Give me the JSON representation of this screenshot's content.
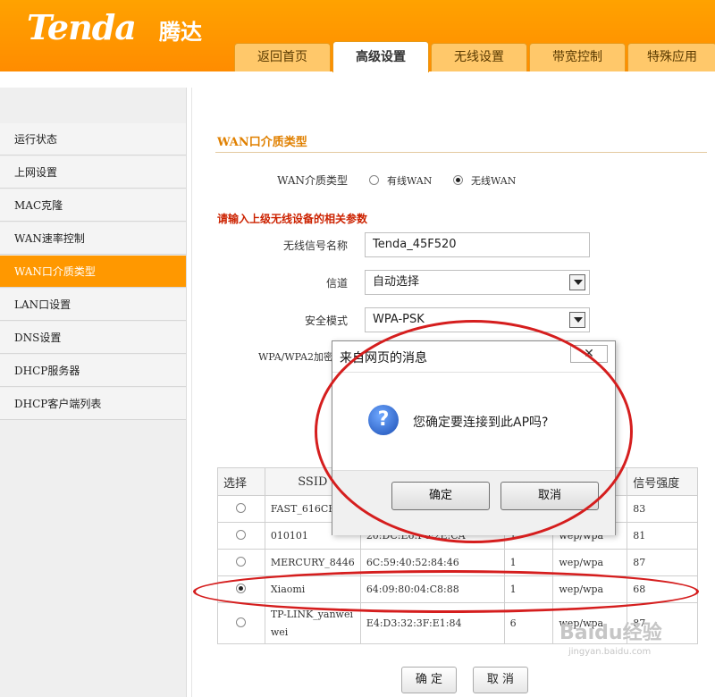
{
  "header": {
    "logo_text": "Tenda",
    "logo_cn": "腾达",
    "tabs": [
      "返回首页",
      "高级设置",
      "无线设置",
      "带宽控制",
      "特殊应用"
    ],
    "active_tab": 1
  },
  "sidebar": {
    "items": [
      "运行状态",
      "上网设置",
      "MAC克隆",
      "WAN速率控制",
      "WAN口介质类型",
      "LAN口设置",
      "DNS设置",
      "DHCP服务器",
      "DHCP客户端列表"
    ],
    "active_index": 4
  },
  "main": {
    "section_title": "WAN口介质类型",
    "media_type_label": "WAN介质类型",
    "radio_wired": "有线WAN",
    "radio_wireless": "无线WAN",
    "radio_selected": "无线WAN",
    "prompt": "请输入上级无线设备的相关参数",
    "ssid_label": "无线信号名称",
    "ssid_value": "Tenda_45F520",
    "channel_label": "信道",
    "channel_value": "自动选择",
    "security_label": "安全模式",
    "security_value": "WPA-PSK",
    "wpa_label": "WPA/WPA2加密规",
    "ok_label": "确 定",
    "cancel_label": "取 消"
  },
  "table": {
    "headers": [
      "选择",
      "SSID",
      "",
      "",
      "",
      "信号强度"
    ],
    "rows": [
      {
        "ssid": "FAST_616CB4",
        "mac": "",
        "channel": "",
        "security": "",
        "signal": "83",
        "selected": false
      },
      {
        "ssid": "010101",
        "mac": "20:DC:E6:F6:2E:CA",
        "channel": "1",
        "security": "wep/wpa",
        "signal": "81",
        "selected": false
      },
      {
        "ssid": "MERCURY_8446",
        "mac": "6C:59:40:52:84:46",
        "channel": "1",
        "security": "wep/wpa",
        "signal": "87",
        "selected": false
      },
      {
        "ssid": "Xiaomi",
        "mac": "64:09:80:04:C8:88",
        "channel": "1",
        "security": "wep/wpa",
        "signal": "68",
        "selected": true
      },
      {
        "ssid": "TP-LINK_yanweiwei",
        "mac": "E4:D3:32:3F:E1:84",
        "channel": "6",
        "security": "wep/wpa",
        "signal": "87",
        "selected": false
      }
    ]
  },
  "dialog": {
    "title": "来自网页的消息",
    "message": "您确定要连接到此AP吗?",
    "icon": "question-icon",
    "ok": "确定",
    "cancel": "取消",
    "close": "✕"
  },
  "watermark": {
    "logo": "Baidu经验",
    "url": "jingyan.baidu.com"
  },
  "colors": {
    "header_orange": "#ff9800",
    "section_orange": "#e08000",
    "annotation_red": "#d51e1e"
  }
}
